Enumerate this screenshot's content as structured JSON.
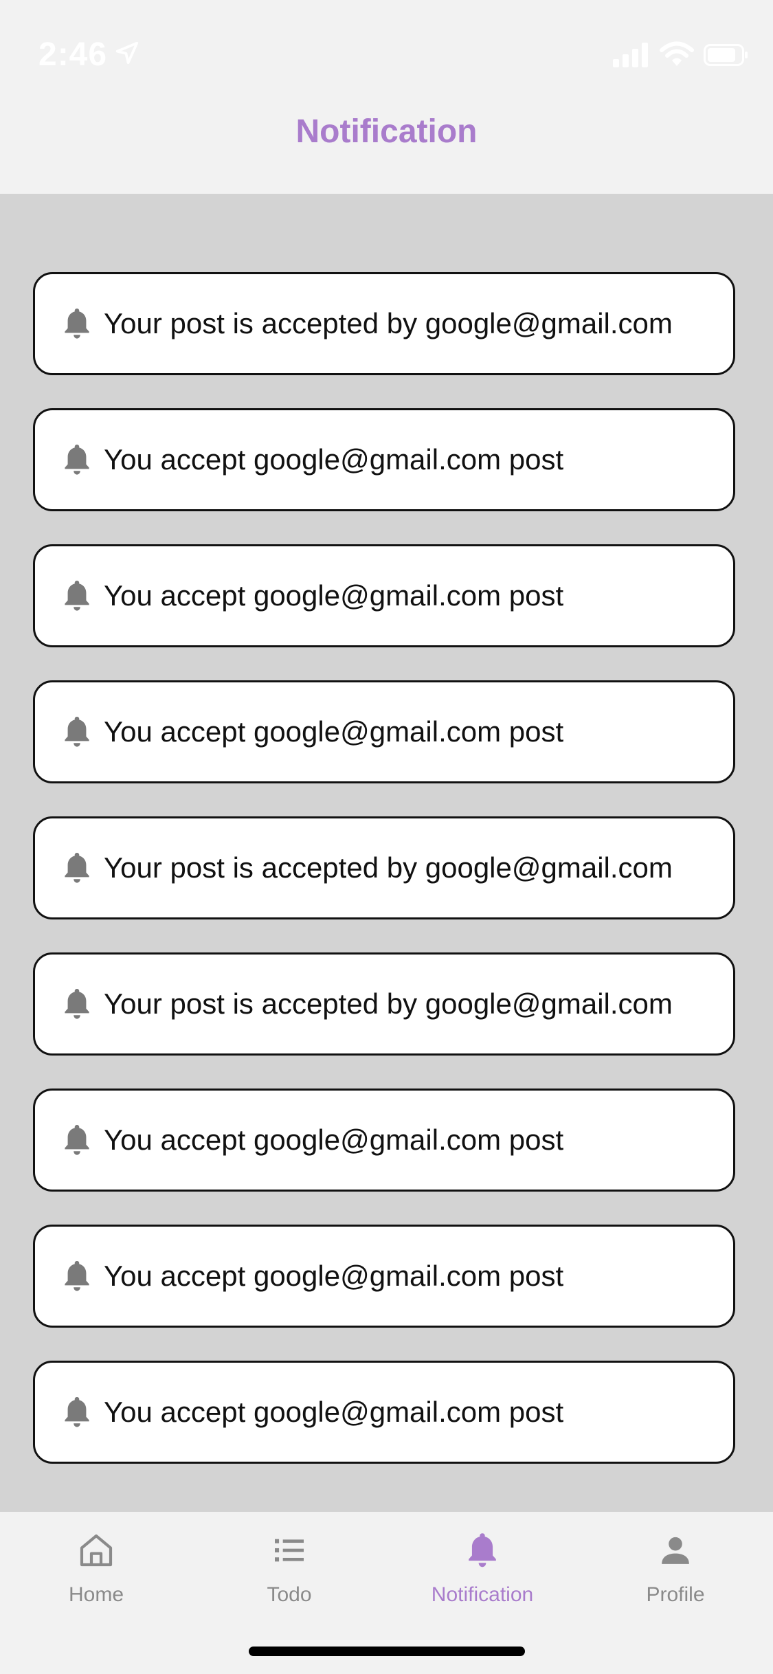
{
  "status_bar": {
    "time": "2:46",
    "icons": [
      "location-arrow-icon",
      "signal-icon",
      "wifi-icon",
      "battery-icon"
    ]
  },
  "header": {
    "title": "Notification"
  },
  "notifications": [
    {
      "icon": "bell-icon",
      "text": "Your post is accepted by google@gmail.com"
    },
    {
      "icon": "bell-icon",
      "text": "You accept google@gmail.com post"
    },
    {
      "icon": "bell-icon",
      "text": "You accept google@gmail.com post"
    },
    {
      "icon": "bell-icon",
      "text": "You accept google@gmail.com post"
    },
    {
      "icon": "bell-icon",
      "text": "Your post is accepted by google@gmail.com"
    },
    {
      "icon": "bell-icon",
      "text": "Your post is accepted by google@gmail.com"
    },
    {
      "icon": "bell-icon",
      "text": "You accept google@gmail.com post"
    },
    {
      "icon": "bell-icon",
      "text": "You accept google@gmail.com post"
    },
    {
      "icon": "bell-icon",
      "text": "You accept google@gmail.com post"
    }
  ],
  "tabbar": {
    "active": "Notification",
    "tabs": [
      {
        "label": "Home",
        "icon": "home-icon"
      },
      {
        "label": "Todo",
        "icon": "list-icon"
      },
      {
        "label": "Notification",
        "icon": "bell-icon"
      },
      {
        "label": "Profile",
        "icon": "person-icon"
      }
    ]
  },
  "colors": {
    "accent": "#a97ccc",
    "background": "#d3d3d3",
    "bar": "#f2f2f2",
    "inactive": "#8a8a8a"
  }
}
